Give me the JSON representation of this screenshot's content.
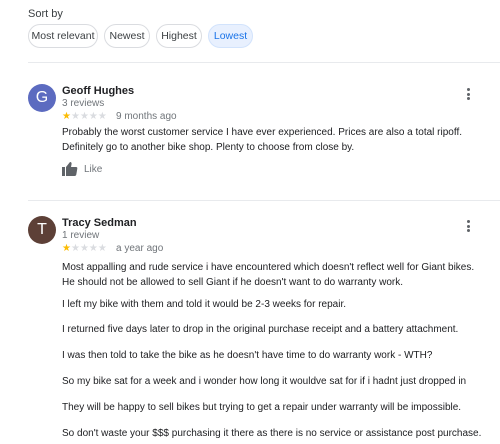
{
  "sort": {
    "label": "Sort by",
    "options": [
      "Most relevant",
      "Newest",
      "Highest",
      "Lowest"
    ],
    "selected": "Lowest"
  },
  "reviews": [
    {
      "avatar_letter": "G",
      "avatar_color": "#5c6bc0",
      "name": "Geoff Hughes",
      "count": "3 reviews",
      "rating": 1,
      "max_rating": 5,
      "date": "9 months ago",
      "text": "Probably the worst customer service I have ever experienced. Prices are also a total ripoff. Definitely go to another bike shop. Plenty to choose from close by.",
      "like_label": "Like",
      "more_icon": "more-vert-icon"
    },
    {
      "avatar_letter": "T",
      "avatar_color": "#5d4037",
      "name": "Tracy Sedman",
      "count": "1 review",
      "rating": 1,
      "max_rating": 5,
      "date": "a year ago",
      "paragraphs": [
        "Most appalling and rude service i have encountered which doesn't reflect well for Giant bikes. He should not be allowed to sell Giant if he doesn't want to do warranty work.",
        "I left my bike with them and told it would be 2-3 weeks for repair.",
        "I returned five days later to drop in the original purchase receipt and a battery attachment.",
        "I was then told to take the bike as he doesn't have time to do warranty work - WTH?",
        "So my bike sat for a week and i wonder how long it wouldve sat for if i hadnt just dropped in",
        "They will be happy to sell bikes but trying to get a repair under warranty will be impossible.",
        "So don't waste your $$$ purchasing it there as there is no service or assistance post purchase."
      ],
      "more_icon": "more-vert-icon"
    }
  ]
}
